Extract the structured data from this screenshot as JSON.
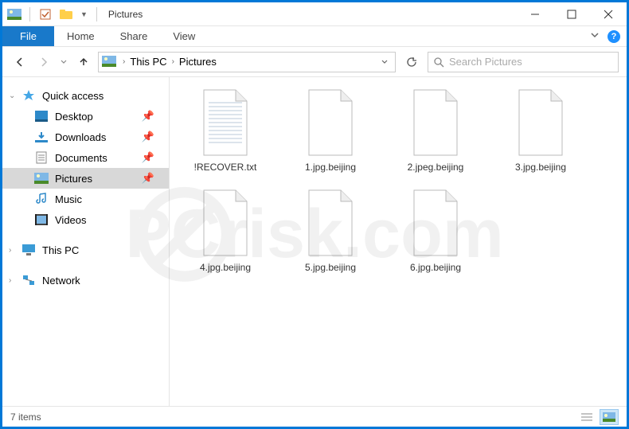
{
  "window": {
    "title": "Pictures"
  },
  "ribbon": {
    "file": "File",
    "tabs": [
      "Home",
      "Share",
      "View"
    ]
  },
  "breadcrumb": {
    "items": [
      "This PC",
      "Pictures"
    ]
  },
  "search": {
    "placeholder": "Search Pictures"
  },
  "sidebar": {
    "quick_access": "Quick access",
    "items": [
      {
        "label": "Desktop",
        "icon": "desktop"
      },
      {
        "label": "Downloads",
        "icon": "downloads"
      },
      {
        "label": "Documents",
        "icon": "documents"
      },
      {
        "label": "Pictures",
        "icon": "pictures",
        "selected": true
      },
      {
        "label": "Music",
        "icon": "music"
      },
      {
        "label": "Videos",
        "icon": "videos"
      }
    ],
    "this_pc": "This PC",
    "network": "Network"
  },
  "files": [
    {
      "label": "!RECOVER.txt",
      "type": "text"
    },
    {
      "label": "1.jpg.beijing",
      "type": "unknown"
    },
    {
      "label": "2.jpeg.beijing",
      "type": "unknown"
    },
    {
      "label": "3.jpg.beijing",
      "type": "unknown"
    },
    {
      "label": "4.jpg.beijing",
      "type": "unknown"
    },
    {
      "label": "5.jpg.beijing",
      "type": "unknown"
    },
    {
      "label": "6.jpg.beijing",
      "type": "unknown"
    }
  ],
  "status": {
    "count": "7 items"
  }
}
